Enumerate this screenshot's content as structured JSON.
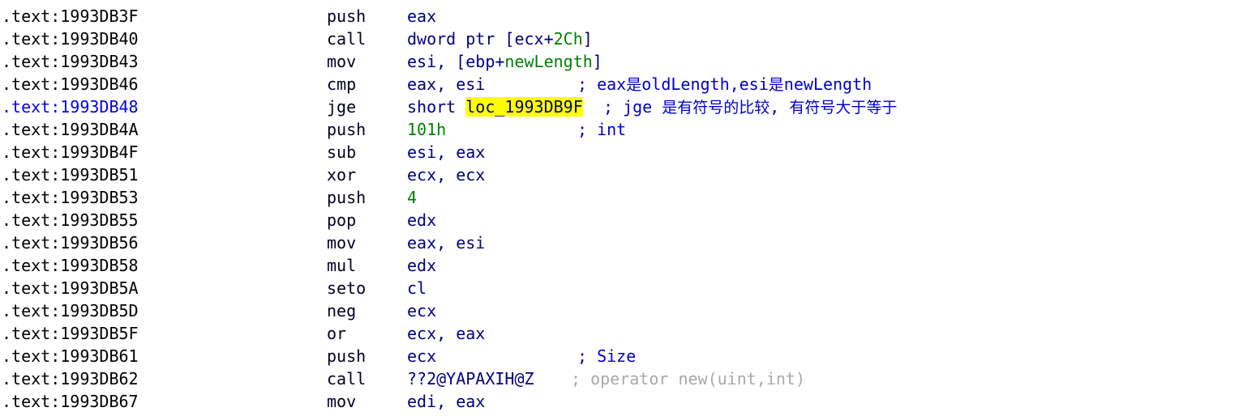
{
  "view": {
    "name": "IDA View-A disassembly listing",
    "segment": "text",
    "background_color": "#ffffff",
    "address_color": "#000000",
    "current_line_address_color": "#0000ee",
    "mnemonic_color": "#000022",
    "operand_color": "#000080",
    "immediate_color": "#008000",
    "comment_color": "#0000cc",
    "auto_comment_color": "#a9a9a9",
    "highlight_background": "#ffff00"
  },
  "partial_top_line": {
    "note": "clipped partial row above first full line"
  },
  "lines": [
    {
      "address": ".text:1993DB3F",
      "mnemonic": "push",
      "operands": [
        {
          "text": "eax",
          "kind": "reg"
        }
      ],
      "comment": "",
      "comment_kind": "",
      "current": false
    },
    {
      "address": ".text:1993DB40",
      "mnemonic": "call",
      "operands": [
        {
          "text": "dword ptr [ecx+",
          "kind": "reg"
        },
        {
          "text": "2Ch",
          "kind": "num"
        },
        {
          "text": "]",
          "kind": "reg"
        }
      ],
      "comment": "",
      "comment_kind": "",
      "current": false
    },
    {
      "address": ".text:1993DB43",
      "mnemonic": "mov",
      "operands": [
        {
          "text": "esi, [ebp+",
          "kind": "reg"
        },
        {
          "text": "newLength",
          "kind": "var"
        },
        {
          "text": "]",
          "kind": "reg"
        }
      ],
      "comment": "",
      "comment_kind": "",
      "current": false
    },
    {
      "address": ".text:1993DB46",
      "mnemonic": "cmp",
      "operands": [
        {
          "text": "eax, esi",
          "kind": "reg"
        }
      ],
      "comment": "; eax是oldLength,esi是newLength",
      "comment_kind": "user",
      "comment_col": "cmt-c1",
      "current": false
    },
    {
      "address": ".text:1993DB48",
      "mnemonic": "jge",
      "operands": [
        {
          "text": "short ",
          "kind": "reg"
        },
        {
          "text": "loc_1993DB9F",
          "kind": "highlight"
        }
      ],
      "comment": "; jge 是有符号的比较, 有符号大于等于",
      "comment_kind": "user",
      "comment_col": "cmt-c2",
      "current": true
    },
    {
      "address": ".text:1993DB4A",
      "mnemonic": "push",
      "operands": [
        {
          "text": "101h",
          "kind": "num"
        }
      ],
      "comment": "; int",
      "comment_kind": "user",
      "comment_col": "cmt-c1",
      "current": false
    },
    {
      "address": ".text:1993DB4F",
      "mnemonic": "sub",
      "operands": [
        {
          "text": "esi, eax",
          "kind": "reg"
        }
      ],
      "comment": "",
      "comment_kind": "",
      "current": false
    },
    {
      "address": ".text:1993DB51",
      "mnemonic": "xor",
      "operands": [
        {
          "text": "ecx, ecx",
          "kind": "reg"
        }
      ],
      "comment": "",
      "comment_kind": "",
      "current": false
    },
    {
      "address": ".text:1993DB53",
      "mnemonic": "push",
      "operands": [
        {
          "text": "4",
          "kind": "num"
        }
      ],
      "comment": "",
      "comment_kind": "",
      "current": false
    },
    {
      "address": ".text:1993DB55",
      "mnemonic": "pop",
      "operands": [
        {
          "text": "edx",
          "kind": "reg"
        }
      ],
      "comment": "",
      "comment_kind": "",
      "current": false
    },
    {
      "address": ".text:1993DB56",
      "mnemonic": "mov",
      "operands": [
        {
          "text": "eax, esi",
          "kind": "reg"
        }
      ],
      "comment": "",
      "comment_kind": "",
      "current": false
    },
    {
      "address": ".text:1993DB58",
      "mnemonic": "mul",
      "operands": [
        {
          "text": "edx",
          "kind": "reg"
        }
      ],
      "comment": "",
      "comment_kind": "",
      "current": false
    },
    {
      "address": ".text:1993DB5A",
      "mnemonic": "seto",
      "operands": [
        {
          "text": "cl",
          "kind": "reg"
        }
      ],
      "comment": "",
      "comment_kind": "",
      "current": false
    },
    {
      "address": ".text:1993DB5D",
      "mnemonic": "neg",
      "operands": [
        {
          "text": "ecx",
          "kind": "reg"
        }
      ],
      "comment": "",
      "comment_kind": "",
      "current": false
    },
    {
      "address": ".text:1993DB5F",
      "mnemonic": "or",
      "operands": [
        {
          "text": "ecx, eax",
          "kind": "reg"
        }
      ],
      "comment": "",
      "comment_kind": "",
      "current": false
    },
    {
      "address": ".text:1993DB61",
      "mnemonic": "push",
      "operands": [
        {
          "text": "ecx",
          "kind": "reg"
        }
      ],
      "comment": "; Size",
      "comment_kind": "user",
      "comment_col": "cmt-c1",
      "current": false
    },
    {
      "address": ".text:1993DB62",
      "mnemonic": "call",
      "operands": [
        {
          "text": "??2@YAPAXIH@Z",
          "kind": "reg"
        }
      ],
      "comment": "; operator new(uint,int)",
      "comment_kind": "auto",
      "comment_col": "cmt-c3",
      "current": false
    },
    {
      "address": ".text:1993DB67",
      "mnemonic": "mov",
      "operands": [
        {
          "text": "edi, eax",
          "kind": "reg"
        }
      ],
      "comment": "",
      "comment_kind": "",
      "current": false
    }
  ]
}
